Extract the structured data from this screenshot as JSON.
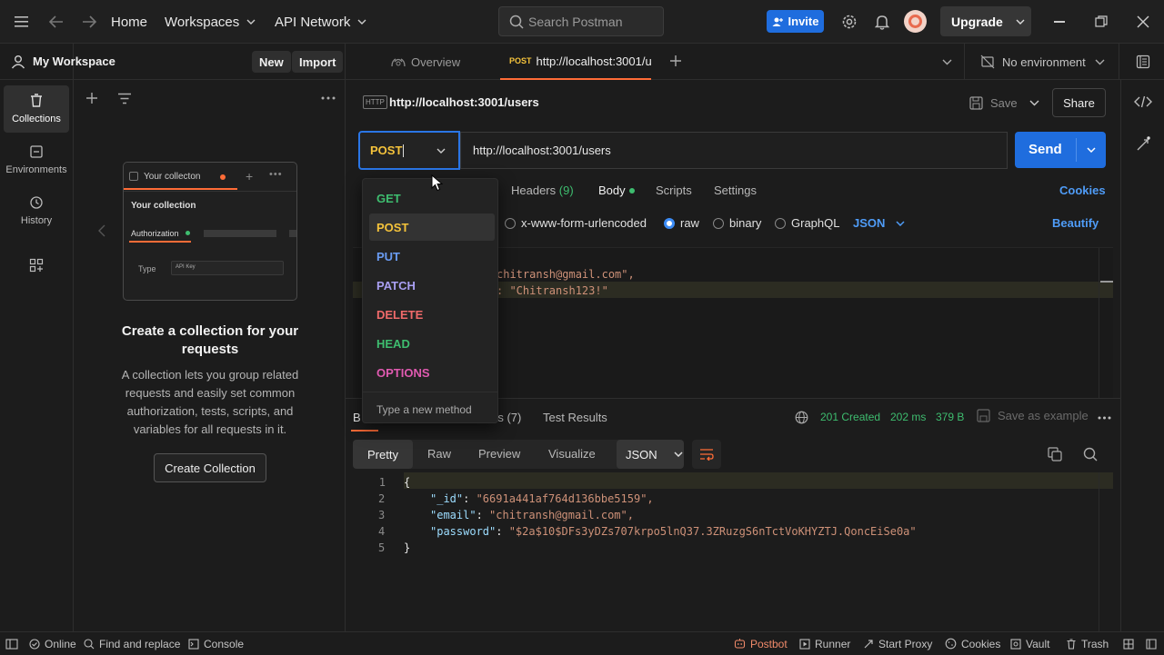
{
  "topbar": {
    "home": "Home",
    "workspaces": "Workspaces",
    "api_network": "API Network",
    "search_placeholder": "Search Postman",
    "invite": "Invite",
    "upgrade": "Upgrade"
  },
  "rail": {
    "collections": "Collections",
    "environments": "Environments",
    "history": "History"
  },
  "sidebar": {
    "workspace_name": "My Workspace",
    "new_btn": "New",
    "import_btn": "Import",
    "illustration": {
      "tab_label": "Your collecton",
      "collection_label": "Your collection",
      "auth_label": "Authorization",
      "type_label": "Type",
      "type_value": "API Key"
    },
    "empty_title": "Create a collection for your requests",
    "empty_desc": "A collection lets you group related requests and easily set common authorization, tests, scripts, and variables for all requests in it.",
    "create_btn": "Create Collection"
  },
  "tabs": {
    "overview": "Overview",
    "active_method": "POST",
    "active_url": "http://localhost:3001/u",
    "environment": "No environment"
  },
  "request": {
    "title": "http://localhost:3001/users",
    "save": "Save",
    "share": "Share",
    "method": "POST",
    "url": "http://localhost:3001/users",
    "send": "Send",
    "tabs": {
      "headers": "Headers",
      "headers_count": "(9)",
      "body": "Body",
      "scripts": "Scripts",
      "settings": "Settings",
      "cookies": "Cookies"
    },
    "body_types": {
      "urlencoded": "x-www-form-urlencoded",
      "raw": "raw",
      "binary": "binary",
      "graphql": "GraphQL",
      "json": "JSON",
      "beautify": "Beautify"
    },
    "body_lines": [
      "chitransh@gmail.com\",",
      ": \"Chitransh123!\""
    ]
  },
  "method_dropdown": {
    "items": [
      {
        "label": "GET",
        "color": "#3ebd6f"
      },
      {
        "label": "POST",
        "color": "#f5c33b"
      },
      {
        "label": "PUT",
        "color": "#6a9cf3"
      },
      {
        "label": "PATCH",
        "color": "#a99ff2"
      },
      {
        "label": "DELETE",
        "color": "#f06a6a"
      },
      {
        "label": "HEAD",
        "color": "#3ebd6f"
      },
      {
        "label": "OPTIONS",
        "color": "#e05ab0"
      }
    ],
    "custom_hint": "Type a new method"
  },
  "response": {
    "tab_body": "B",
    "tab_headers": "rs (7)",
    "tab_tests": "Test Results",
    "status": "201 Created",
    "time": "202 ms",
    "size": "379 B",
    "save_example": "Save as example",
    "view_tabs": [
      "Pretty",
      "Raw",
      "Preview",
      "Visualize"
    ],
    "format": "JSON",
    "line_numbers": [
      "1",
      "2",
      "3",
      "4",
      "5"
    ],
    "lines": [
      {
        "key": "",
        "val": "{"
      },
      {
        "key": "\"_id\"",
        "val": "\"6691a441af764d136bbe5159\","
      },
      {
        "key": "\"email\"",
        "val": "\"chitransh@gmail.com\","
      },
      {
        "key": "\"password\"",
        "val": "\"$2a$10$DFs3yDZs707krpo5lnQ37.3ZRuzgS6nTctVoKHYZTJ.QoncEiSe0a\""
      },
      {
        "key": "",
        "val": "}"
      }
    ]
  },
  "statusbar": {
    "online": "Online",
    "find_replace": "Find and replace",
    "console": "Console",
    "postbot": "Postbot",
    "runner": "Runner",
    "start_proxy": "Start Proxy",
    "cookies": "Cookies",
    "vault": "Vault",
    "trash": "Trash"
  },
  "colors": {
    "accent": "#1f6dde",
    "post": "#f5c33b",
    "status_ok": "#3ebd6f",
    "brand": "#ff6c37"
  }
}
